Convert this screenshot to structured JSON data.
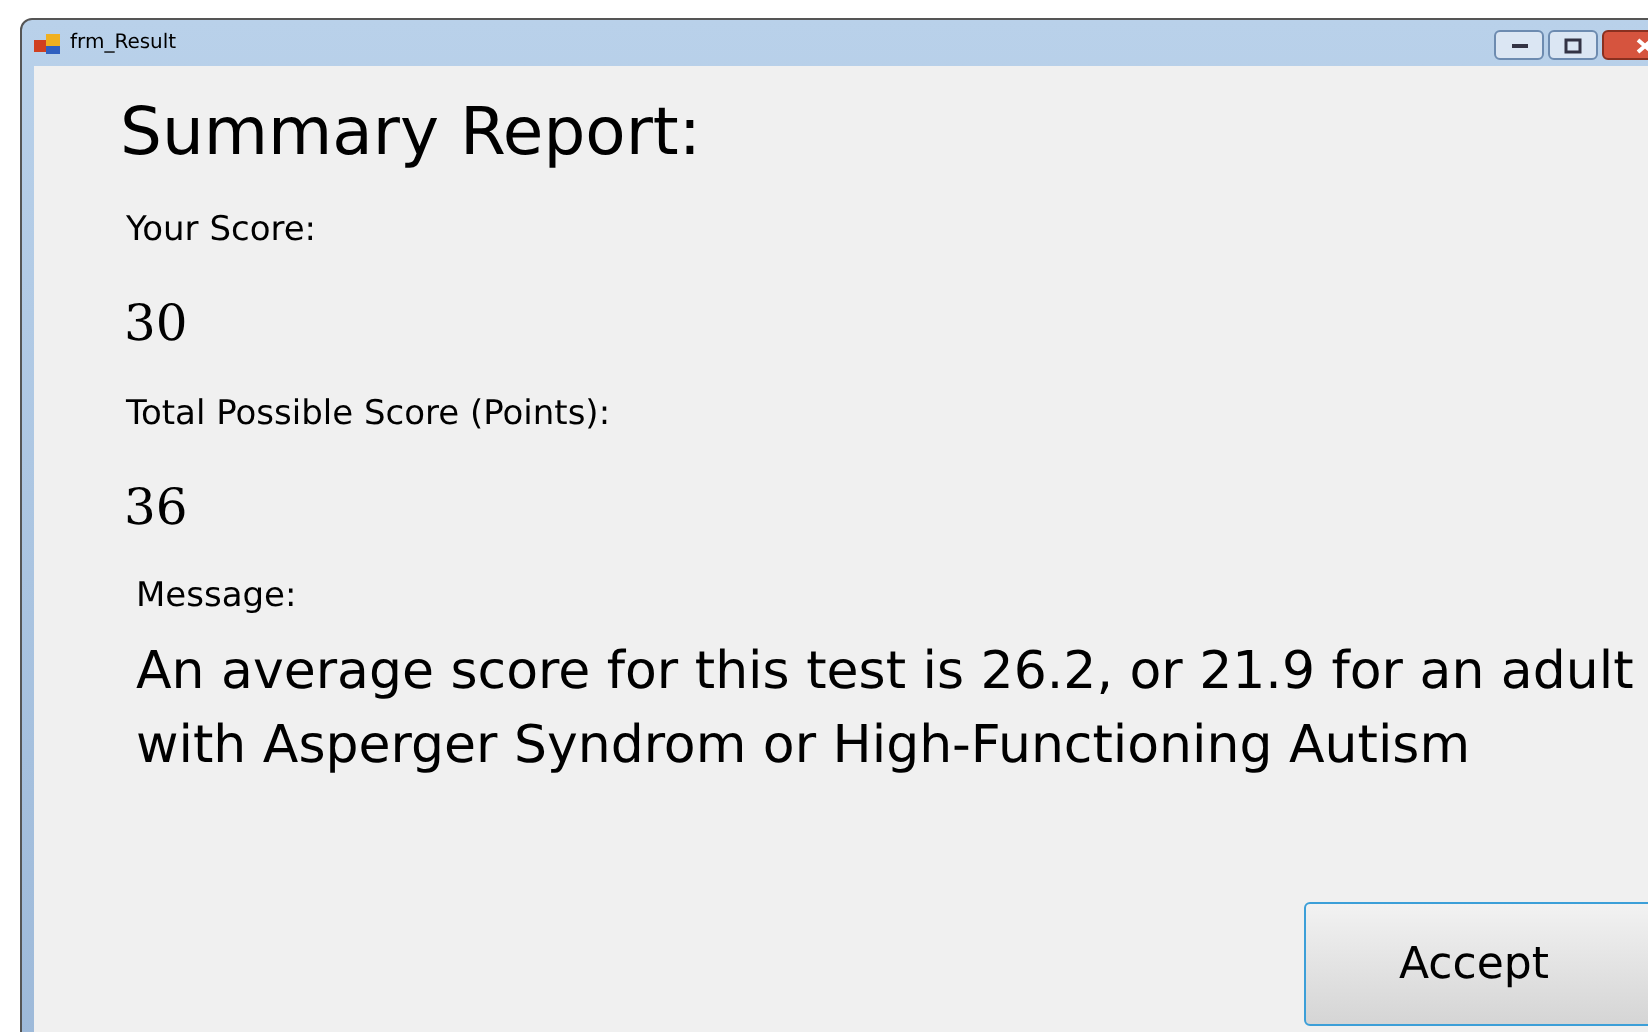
{
  "window": {
    "title": "frm_Result"
  },
  "heading": "Summary Report:",
  "fields": [
    {
      "label": "Your Score:",
      "value": "30"
    },
    {
      "label": "Total Possible Score (Points):",
      "value": "36"
    }
  ],
  "message": {
    "label": "Message:",
    "text": "An average score for this test is 26.2, or 21.9 for an adult with Asperger Syndrom or High-Functioning Autism"
  },
  "buttons": [
    "Accept"
  ]
}
